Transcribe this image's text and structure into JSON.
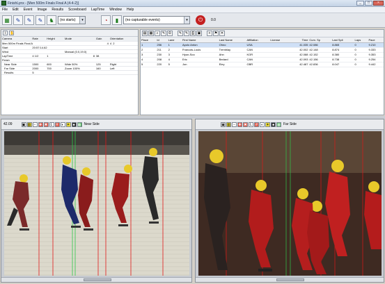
{
  "window": {
    "title": "FinishLynx - [Men 500m Finals Final A (4-4-2)]",
    "controls": [
      "_",
      "□",
      "×"
    ]
  },
  "menu": [
    "File",
    "Edit",
    "Event",
    "Image",
    "Results",
    "Scoreboard",
    "LapTime",
    "Window",
    "Help"
  ],
  "toolbar": {
    "starts_combo": "(no starts)",
    "events_combo": "(no capturable events)",
    "readout": "0.0"
  },
  "event_panel": {
    "columns": [
      "Camera",
      "Rate",
      "Height",
      "Mode",
      "Gain",
      "Orientation"
    ],
    "event_row": {
      "name": "Men 500m Finals Final A",
      "c1": "4",
      "c2": "4",
      "c3": "2"
    },
    "start": {
      "label": "Start",
      "value": "20:57:14.62"
    },
    "wind": {
      "label": "Wind",
      "value": "Manual (0.0,19.0)"
    },
    "laptime": {
      "label": "LapTime",
      "a": "4 1/2",
      "b": "1",
      "c": "8",
      "d": "38"
    },
    "finish_label": "Finish",
    "near_side": {
      "label": "Near Side",
      "rate": "1500",
      "height": "600",
      "mode": "Wide 50%",
      "gain": "125",
      "orientation": "Right"
    },
    "far_side": {
      "label": "Far Side",
      "rate": "2000",
      "height": "700",
      "mode": "Zoom 100%",
      "gain": "160",
      "orientation": "Left"
    },
    "results": {
      "label": "Results",
      "value": "5"
    }
  },
  "results_panel": {
    "columns": [
      "Place",
      "Id",
      "Lane",
      "First Name",
      "Last Name",
      "Affiliation",
      "License",
      "Time",
      "Cum. Sp",
      "Last Spli",
      "Laps",
      "Pace"
    ],
    "rows": [
      {
        "place": "1",
        "id": "256",
        "lane": "1",
        "first": "Apolo Anton",
        "last": "Ohno",
        "aff": "USA",
        "lic": "",
        "time": "41.035",
        "cum": "42.086",
        "last_split": "8.865",
        "laps": "0",
        "pace": "9.210"
      },
      {
        "place": "2",
        "id": "211",
        "lane": "2",
        "first": "Francois-Louis",
        "last": "Tremblay",
        "aff": "CAN",
        "lic": "",
        "time": "42.002",
        "cum": "42.148",
        "last_split": "8.874",
        "laps": "0",
        "pace": "9.333"
      },
      {
        "place": "3",
        "id": "230",
        "lane": "3",
        "first": "Hyun-Soo",
        "last": "Ahn",
        "aff": "KOR",
        "lic": "",
        "time": "42.088",
        "cum": "42.152",
        "last_split": "8.380",
        "laps": "0",
        "pace": "9.353"
      },
      {
        "place": "4",
        "id": "208",
        "lane": "4",
        "first": "Eric",
        "last": "Bedard",
        "aff": "CAN",
        "lic": "",
        "time": "42.093",
        "cum": "42.156",
        "last_split": "8.738",
        "laps": "0",
        "pace": "9.254"
      },
      {
        "place": "5",
        "id": "220",
        "lane": "5",
        "first": "Jon",
        "last": "Eley",
        "aff": "GBR",
        "lic": "",
        "time": "42.487",
        "cum": "42.836",
        "last_split": "8.047",
        "laps": "0",
        "pace": "9.442"
      }
    ]
  },
  "video_near": {
    "timecode": "42.09",
    "camera_label": "Near Side"
  },
  "video_far": {
    "timecode": "",
    "camera_label": "Far Side"
  },
  "colors": {
    "accent": "#1d3fa0",
    "selection": "#cfe0f6",
    "stop": "#c42020",
    "line_red": "#e01818",
    "line_green": "#2ec84a"
  }
}
